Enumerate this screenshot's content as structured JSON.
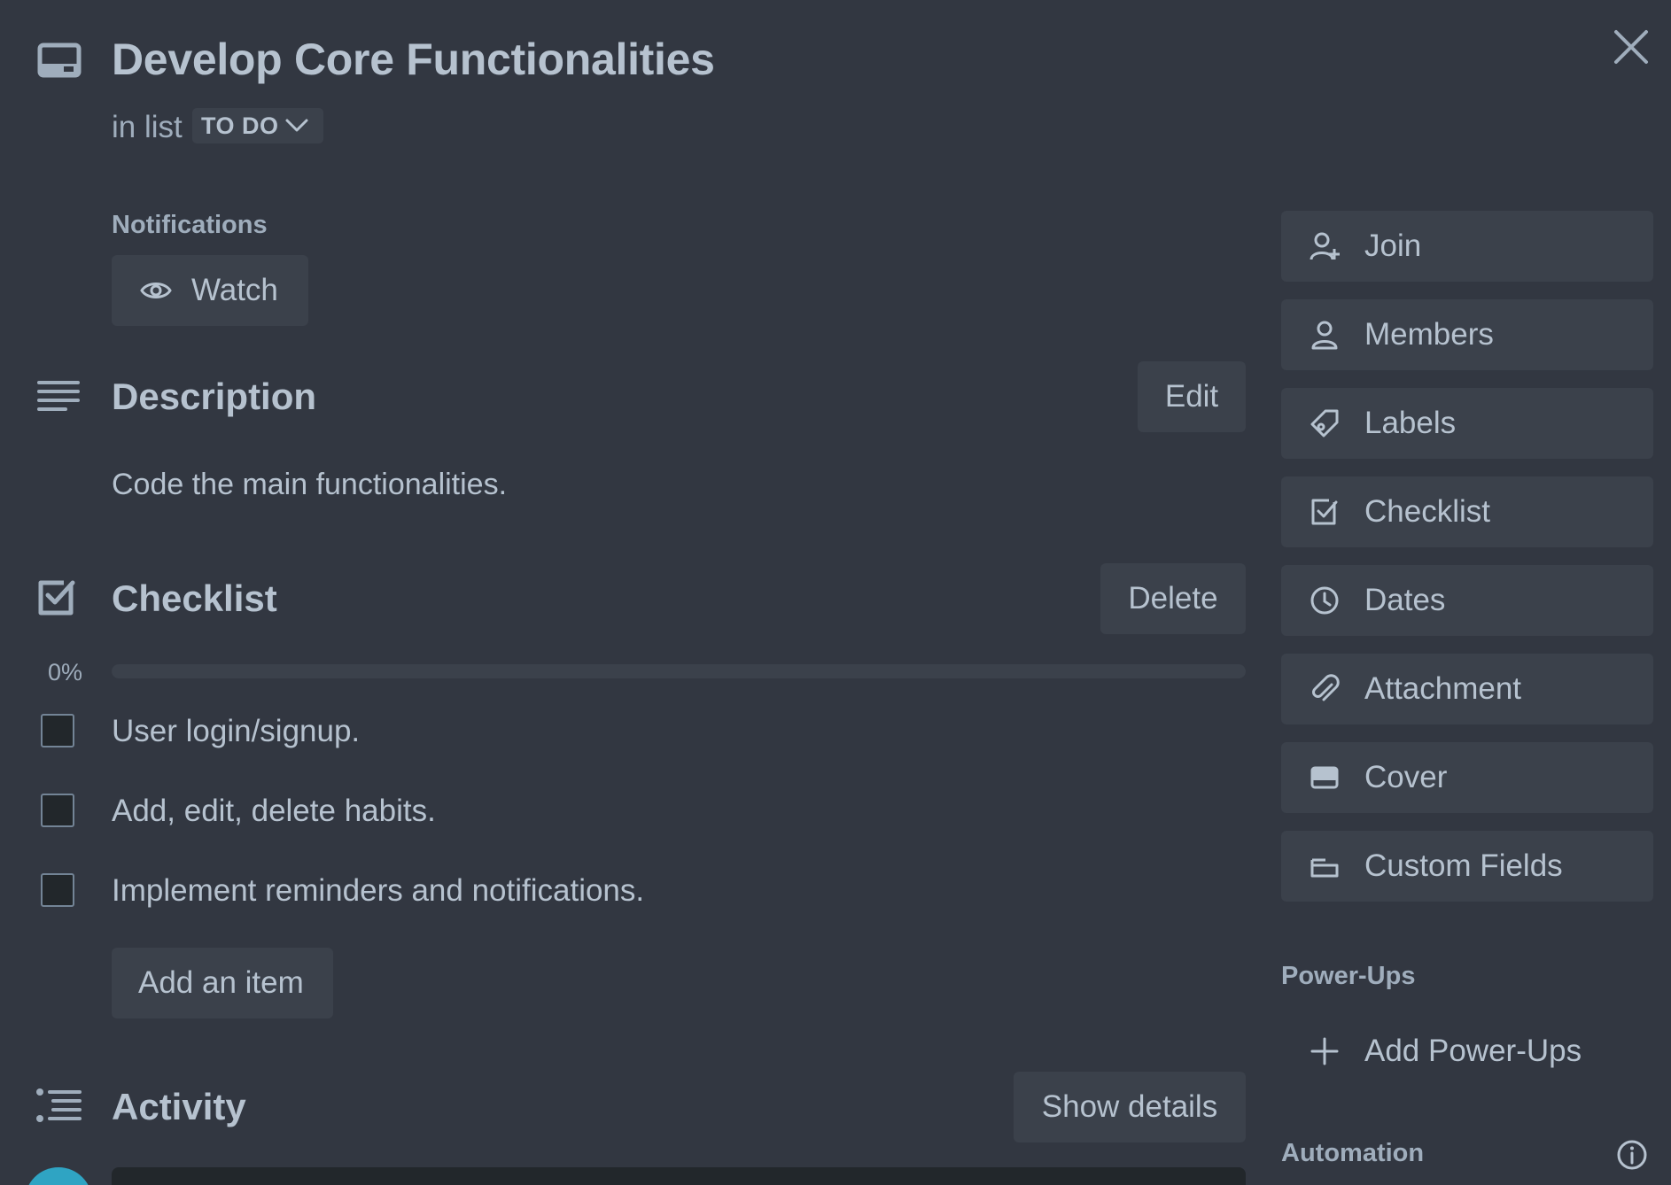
{
  "card": {
    "title": "Develop Core Functionalities",
    "in_list_text": "in list",
    "list_name": "TO DO"
  },
  "notifications": {
    "label": "Notifications",
    "watch_label": "Watch"
  },
  "description": {
    "title": "Description",
    "edit_label": "Edit",
    "text": "Code the main functionalities."
  },
  "checklist": {
    "title": "Checklist",
    "delete_label": "Delete",
    "progress": 0,
    "progress_text": "0%",
    "items": [
      {
        "text": "User login/signup.",
        "checked": false
      },
      {
        "text": "Add, edit, delete habits.",
        "checked": false
      },
      {
        "text": "Implement reminders and notifications.",
        "checked": false
      }
    ],
    "add_item_label": "Add an item"
  },
  "activity": {
    "title": "Activity",
    "show_details_label": "Show details"
  },
  "sidebar": {
    "buttons": [
      {
        "label": "Join",
        "icon": "add-member-icon"
      },
      {
        "label": "Members",
        "icon": "person-icon"
      },
      {
        "label": "Labels",
        "icon": "tag-icon"
      },
      {
        "label": "Checklist",
        "icon": "checklist-icon"
      },
      {
        "label": "Dates",
        "icon": "clock-icon"
      },
      {
        "label": "Attachment",
        "icon": "paperclip-icon"
      },
      {
        "label": "Cover",
        "icon": "cover-icon"
      },
      {
        "label": "Custom Fields",
        "icon": "custom-fields-icon"
      }
    ],
    "powerups_label": "Power-Ups",
    "add_powerups_label": "Add Power-Ups",
    "automation_label": "Automation"
  },
  "colors": {
    "background": "#323741",
    "button_bg": "#3b414b",
    "text": "#b6c2cf",
    "subtle_text": "#9fadbc",
    "avatar": "#2fa4c3"
  }
}
